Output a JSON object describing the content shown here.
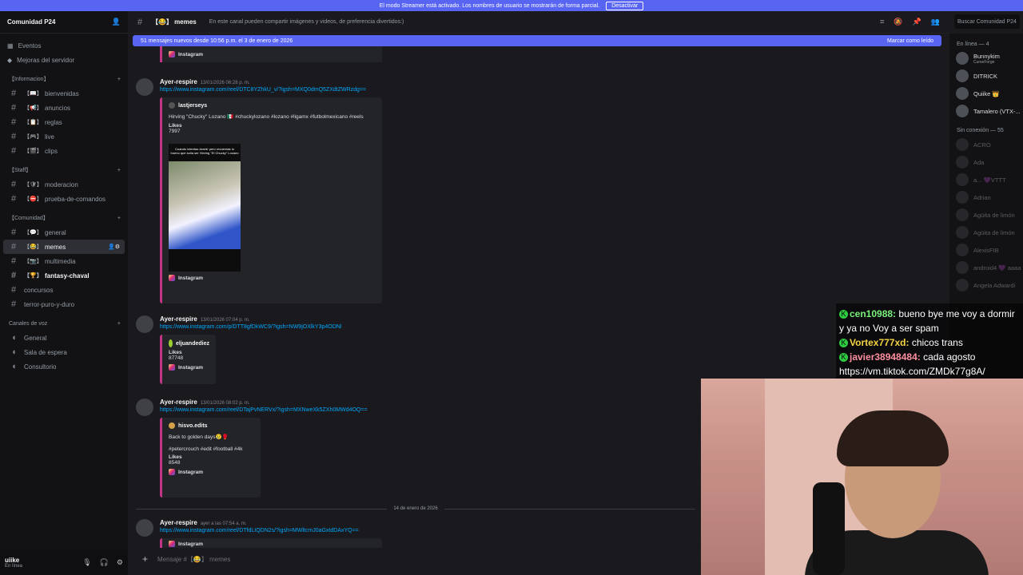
{
  "banner": {
    "text": "El modo Streamer está activado. Los nombres de usuario se mostrarán de forma parcial.",
    "button": "Desactivar"
  },
  "server": {
    "name": "Comunidad P24"
  },
  "sidebar_top": [
    {
      "label": "Eventos"
    },
    {
      "label": "Mejoras del servidor"
    }
  ],
  "categories": [
    {
      "name": "【Informacion】",
      "channels": [
        {
          "emoji": "【📖】",
          "label": "bienvenidas"
        },
        {
          "emoji": "【📢】",
          "label": "anuncios"
        },
        {
          "emoji": "【📋】",
          "label": "reglas"
        },
        {
          "emoji": "【🎮】",
          "label": "live"
        },
        {
          "emoji": "【🎬】",
          "label": "clips"
        }
      ]
    },
    {
      "name": "【Staff】",
      "channels": [
        {
          "emoji": "【🛡】",
          "label": "moderacion"
        },
        {
          "emoji": "【⛔】",
          "label": "prueba-de-comandos"
        }
      ]
    },
    {
      "name": "【Comunidad】",
      "channels": [
        {
          "emoji": "【💬】",
          "label": "general"
        },
        {
          "emoji": "【😂】",
          "label": "memes"
        },
        {
          "emoji": "【📷】",
          "label": "multimedia"
        },
        {
          "emoji": "【🏆】",
          "label": "fantasy-chaval"
        },
        {
          "emoji": "",
          "label": "concursos"
        },
        {
          "emoji": "",
          "label": "terror-puro-y-duro"
        }
      ]
    }
  ],
  "voice": {
    "name": "Canales de voz",
    "channels": [
      {
        "label": "General"
      },
      {
        "label": "Sala de espera"
      },
      {
        "label": "Consultorio"
      }
    ]
  },
  "user_panel": {
    "name": "uiike",
    "status": "En línea"
  },
  "topbar": {
    "channel": "【😂】 memes",
    "topic": "En este canal pueden compartir imágenes y videos, de preferencia divertidos:)",
    "search": "Buscar Comunidad P24"
  },
  "newbar": {
    "text": "51 mensajes nuevos desde 10:56 p.m. el 3 de enero de 2026",
    "action": "Marcar como leído"
  },
  "messages": [
    {
      "author": "Ayer-respire",
      "time": "13/01/2026 06:28 p. m.",
      "link": "https://www.instagram.com/reel/DTC8YZhkU_v/?igsh=MXQ0dmQ5ZXdtZWRzdg==",
      "embed": {
        "name": "lastjerseys",
        "desc": "Hirving \"Chucky\" Lozano 🇲🇽 #chuckylozano #lozano #ligamx #futbolmexicano #reels",
        "likes_label": "Likes",
        "likes": "7997",
        "thumb_caption": "Cuando intentas dormir pero recuerdas lo bueno que solía ser Hirving \"El Chucky\" Lozano",
        "footer": "Instagram"
      }
    },
    {
      "author": "Ayer-respire",
      "time": "13/01/2026 07:04 p. m.",
      "link": "https://www.instagram.com/p/DTT8gfDkWC9/?igsh=NW9jOXlkY3p4ODNl",
      "embed": {
        "name": "eljuandediez",
        "likes_label": "Likes",
        "likes": "87748",
        "footer": "Instagram"
      }
    },
    {
      "author": "Ayer-respire",
      "time": "13/01/2026 08:02 p. m.",
      "link": "https://www.instagram.com/reel/DTajPvNERVx/?igsh=MXNweXk5ZXh0MWd4OQ==",
      "embed": {
        "name": "hisvo.edits",
        "desc": "Back to golden days😢🥊",
        "tags": "#petercrouch #edit #football #4k",
        "likes_label": "Likes",
        "likes": "8548",
        "footer": "Instagram"
      }
    },
    {
      "author": "Ayer-respire",
      "time": "ayer a las 07:54 a. m.",
      "link": "https://www.instagram.com/reel/DTfdLIQDN2s/?igsh=MWltcmJ0aGxtdDAxYQ==",
      "embed": {
        "footer": "Instagram"
      }
    }
  ],
  "top_embed_footer": "Instagram",
  "date_separator": "14 de enero de 2026",
  "input": {
    "placeholder": "Mensaje #【😂】 memes"
  },
  "members": {
    "online_header": "En línea — 4",
    "online": [
      {
        "name": "Bunnykim",
        "sub": "CurseForge"
      },
      {
        "name": "DITRICK"
      },
      {
        "name": "Quiike 👑"
      },
      {
        "name": "Tamalero (VTX-..."
      }
    ],
    "offline_header": "Sin conexión — 55",
    "offline": [
      {
        "name": "ACRO"
      },
      {
        "name": "Ada"
      },
      {
        "name": "a... 💜VTTT"
      },
      {
        "name": "Adrian"
      },
      {
        "name": "Agüita de limón"
      },
      {
        "name": "Agüita de limón"
      },
      {
        "name": "AlexisFIB"
      },
      {
        "name": "android4 💜 aaaa"
      },
      {
        "name": "Angela Adwardi"
      }
    ]
  },
  "stream_chat": [
    {
      "user": "cen10988:",
      "color": "#7cf07c",
      "text": "bueno bye me voy a dormir y ya no Voy a ser spam"
    },
    {
      "user": "Vortex777xd:",
      "color": "#f5d442",
      "text": "chicos trans"
    },
    {
      "user": "javier38948484:",
      "color": "#ff8fa0",
      "text": "cada agosto https://vm.tiktok.com/ZMDk77g8A/"
    }
  ]
}
